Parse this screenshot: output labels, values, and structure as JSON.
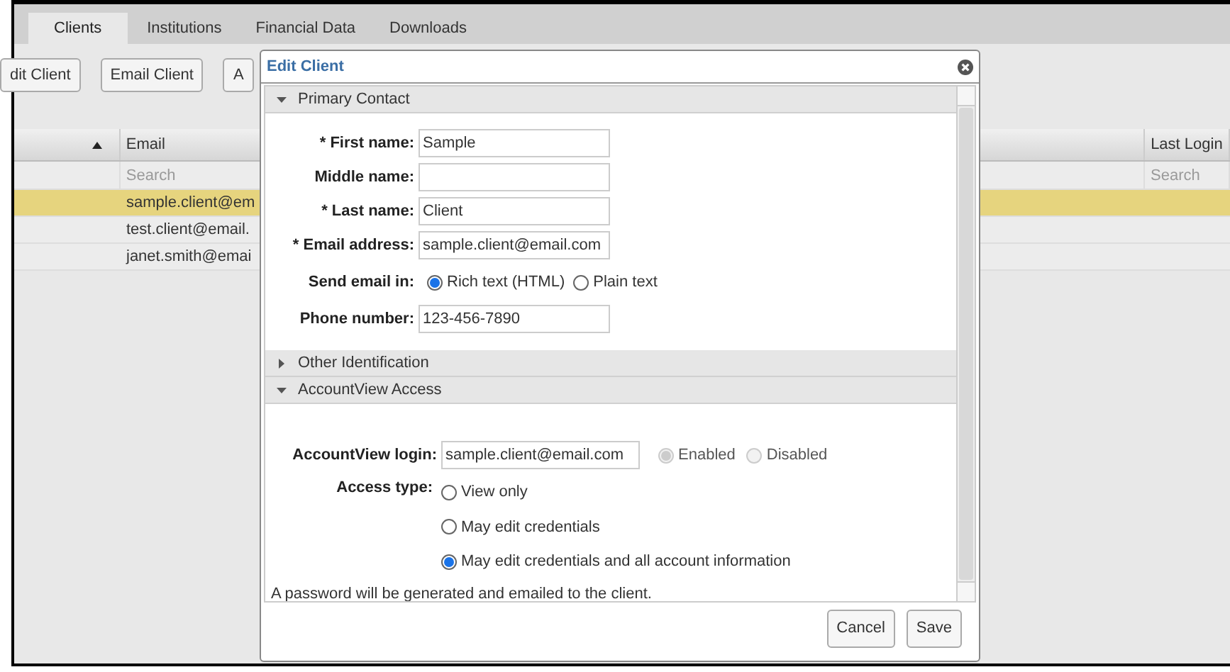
{
  "tabs": [
    {
      "label": "Clients",
      "selected": true
    },
    {
      "label": "Institutions",
      "selected": false
    },
    {
      "label": "Financial Data",
      "selected": false
    },
    {
      "label": "Downloads",
      "selected": false
    }
  ],
  "toolbar": {
    "buttons": [
      "dit Client",
      "Email Client",
      "A"
    ]
  },
  "table": {
    "columns": [
      {
        "label": "Email"
      },
      {
        "label": "Last Login"
      }
    ],
    "search_row": [
      {
        "placeholder": "Search"
      },
      {
        "placeholder": "Search"
      }
    ],
    "rows": [
      {
        "email": "sample.client@em",
        "selected": true
      },
      {
        "email": "test.client@email.",
        "selected": false
      },
      {
        "email": "janet.smith@emai",
        "selected": false
      }
    ]
  },
  "dialog": {
    "title": "Edit Client",
    "sections": [
      {
        "title": "Primary Contact",
        "expanded": true,
        "fields": [
          {
            "kind": "text",
            "label": "* First name:",
            "value": "Sample"
          },
          {
            "kind": "text",
            "label": "Middle name:"
          },
          {
            "kind": "text",
            "label": "* Last name:",
            "value": "Client"
          },
          {
            "kind": "text",
            "label": "* Email address:",
            "value": "sample.client@email.com"
          },
          {
            "kind": "radio",
            "label": "Send email in:",
            "options": [
              {
                "label": "Rich text (HTML)",
                "selected": true,
                "disabled": false
              },
              {
                "label": "Plain text",
                "selected": false,
                "disabled": false
              }
            ]
          },
          {
            "kind": "text",
            "label": "Phone number:",
            "value": "123-456-7890"
          }
        ]
      },
      {
        "title": "Other Identification",
        "expanded": false
      },
      {
        "title": "AccountView Access",
        "expanded": true,
        "fields": [
          {
            "kind": "login",
            "label": "AccountView login:",
            "value": "sample.client@email.com",
            "options": [
              {
                "label": "Enabled",
                "selected": true,
                "disabled": true
              },
              {
                "label": "Disabled",
                "selected": false,
                "disabled": true
              }
            ]
          },
          {
            "kind": "radiolist",
            "label": "Access type:",
            "options": [
              {
                "label": "View only",
                "selected": false,
                "disabled": false
              },
              {
                "label": "May edit credentials",
                "selected": false,
                "disabled": false
              },
              {
                "label": "May edit credentials and all account information",
                "selected": true,
                "disabled": false
              }
            ]
          },
          {
            "kind": "note",
            "text": "A password will be generated and emailed to the client."
          }
        ]
      }
    ],
    "buttons": [
      "Cancel",
      "Save"
    ]
  }
}
